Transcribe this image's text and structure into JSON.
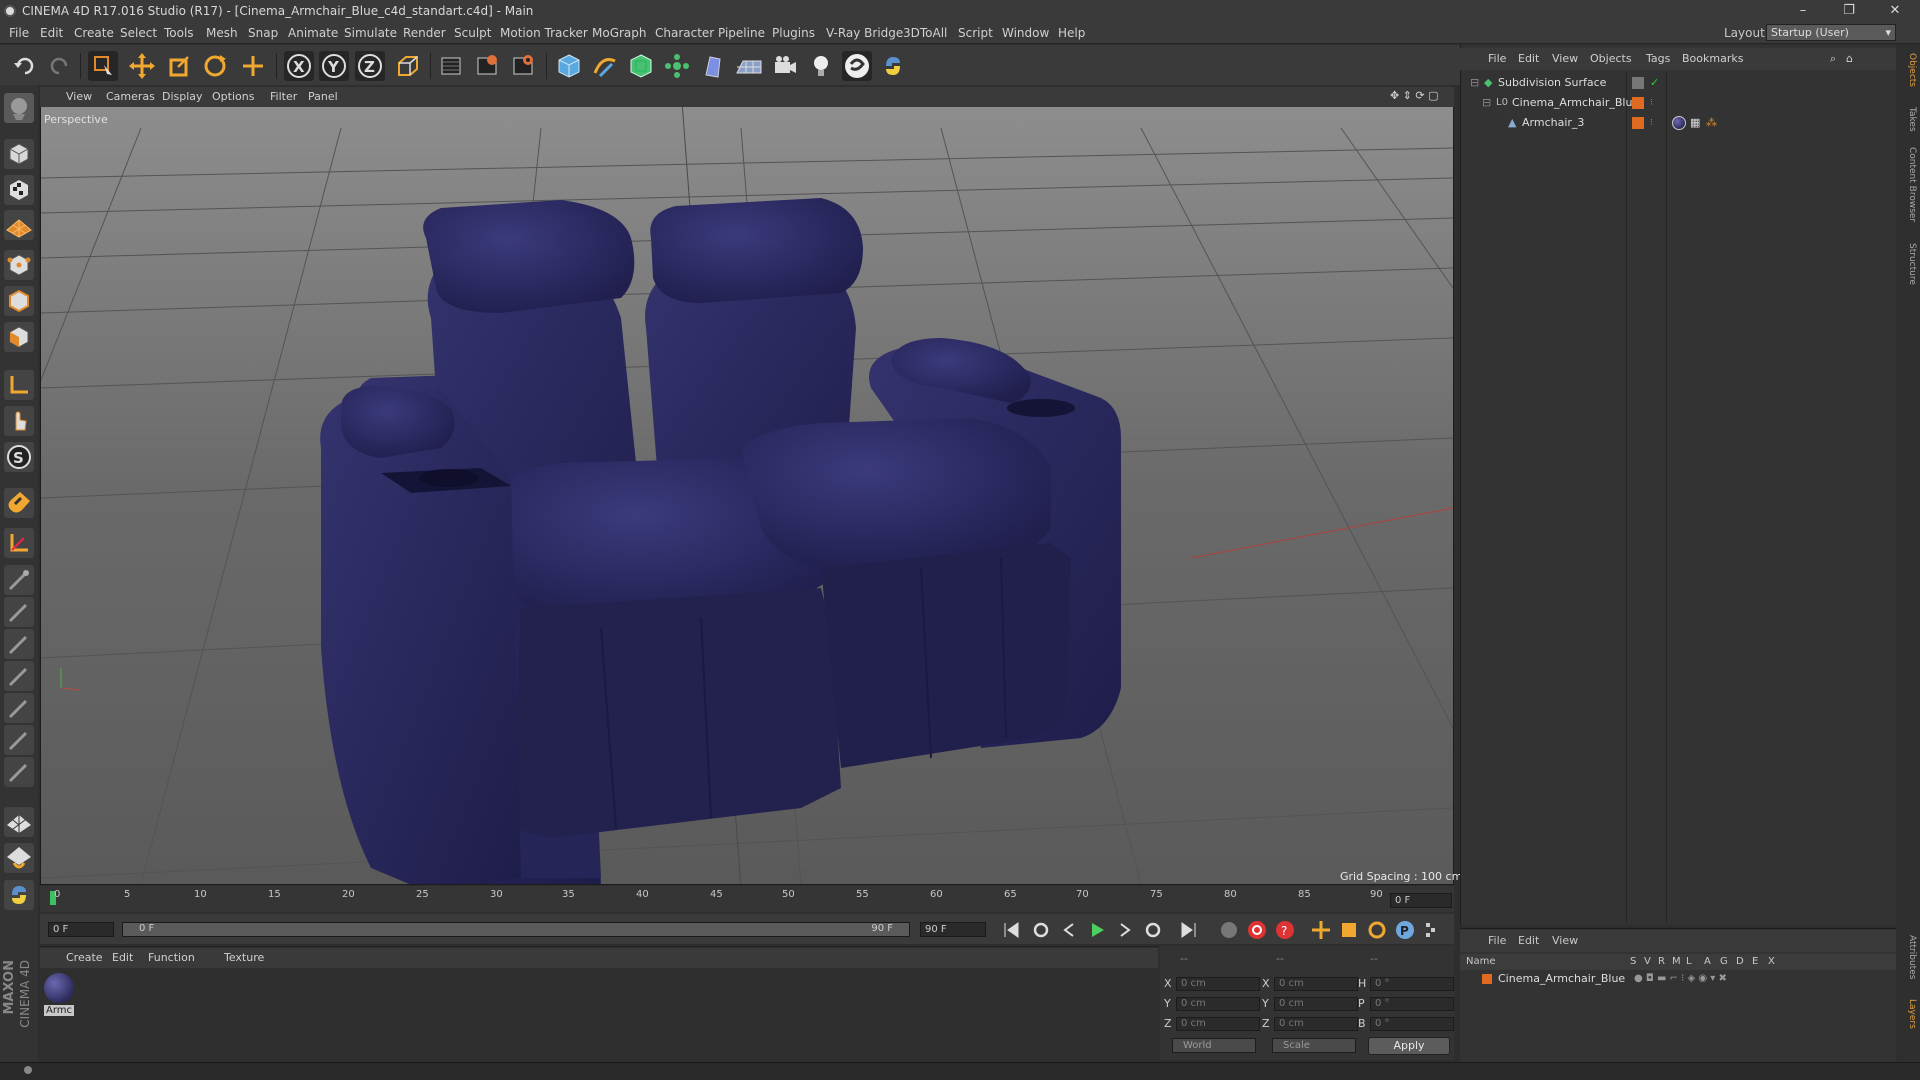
{
  "window": {
    "title": "CINEMA 4D R17.016 Studio (R17) - [Cinema_Armchair_Blue_c4d_standart.c4d] - Main",
    "min": "–",
    "restore": "❐",
    "close": "✕"
  },
  "menu": [
    "File",
    "Edit",
    "Create",
    "Select",
    "Tools",
    "Mesh",
    "Snap",
    "Animate",
    "Simulate",
    "Render",
    "Sculpt",
    "Motion Tracker",
    "MoGraph",
    "Character",
    "Pipeline",
    "Plugins",
    "V-Ray Bridge",
    "3DToAll",
    "Script",
    "Window",
    "Help"
  ],
  "layout": {
    "label": "Layout:",
    "value": "Startup (User)"
  },
  "toolbar": [
    "undo-icon",
    "redo-icon",
    "live-selection-icon",
    "move-icon",
    "scale-icon",
    "rotate-icon",
    "move-alt-icon",
    "x-axis-icon",
    "y-axis-icon",
    "z-axis-icon",
    "world-coord-icon",
    "render-view-icon",
    "render-picture-viewer-icon",
    "edit-render-settings-icon",
    "cube-icon",
    "pen-spline-icon",
    "subdivision-icon",
    "array-icon",
    "deformer-icon",
    "floor-icon",
    "camera-icon",
    "light-icon",
    "python-circle-icon",
    "python-icon"
  ],
  "viewport": {
    "menus": [
      "View",
      "Cameras",
      "Display",
      "Options",
      "Filter",
      "Panel"
    ],
    "label": "Perspective",
    "grid_spacing": "Grid Spacing : 100 cm"
  },
  "timeline": {
    "ticks": [
      "0",
      "5",
      "10",
      "15",
      "20",
      "25",
      "30",
      "35",
      "40",
      "45",
      "50",
      "55",
      "60",
      "65",
      "70",
      "75",
      "80",
      "85",
      "90"
    ],
    "current_frame": "0 F"
  },
  "transport": {
    "start": "0 F",
    "range_start": "0 F",
    "range_end": "90 F",
    "end": "90 F"
  },
  "materials": {
    "menus": [
      "Create",
      "Edit",
      "Function",
      "Texture"
    ],
    "items": [
      {
        "name": "Armc"
      }
    ]
  },
  "coords": {
    "headers": [
      "--",
      "--",
      "--"
    ],
    "rows": [
      {
        "a": "X",
        "av": "0 cm",
        "b": "X",
        "bv": "0 cm",
        "c": "H",
        "cv": "0 °"
      },
      {
        "a": "Y",
        "av": "0 cm",
        "b": "Y",
        "bv": "0 cm",
        "c": "P",
        "cv": "0 °"
      },
      {
        "a": "Z",
        "av": "0 cm",
        "b": "Z",
        "bv": "0 cm",
        "c": "B",
        "cv": "0 °"
      }
    ],
    "mode": "World",
    "scale": "Scale",
    "apply": "Apply"
  },
  "objects": {
    "menus": [
      "File",
      "Edit",
      "View",
      "Objects",
      "Tags",
      "Bookmarks"
    ],
    "items": [
      {
        "name": "Subdivision Surface"
      },
      {
        "name": "Cinema_Armchair_Blue"
      },
      {
        "name": "Armchair_3"
      }
    ]
  },
  "layers": {
    "menus": [
      "File",
      "Edit",
      "View"
    ],
    "header": {
      "name": "Name",
      "cols": [
        "S",
        "V",
        "R",
        "M",
        "L",
        "A",
        "G",
        "D",
        "E",
        "X"
      ]
    },
    "items": [
      {
        "name": "Cinema_Armchair_Blue"
      }
    ]
  },
  "side_tabs": [
    "Objects",
    "Takes",
    "Content Browser",
    "Structure",
    "Attributes",
    "Layers"
  ],
  "brand": {
    "maxon": "MAXON",
    "c4d": "CINEMA 4D"
  }
}
